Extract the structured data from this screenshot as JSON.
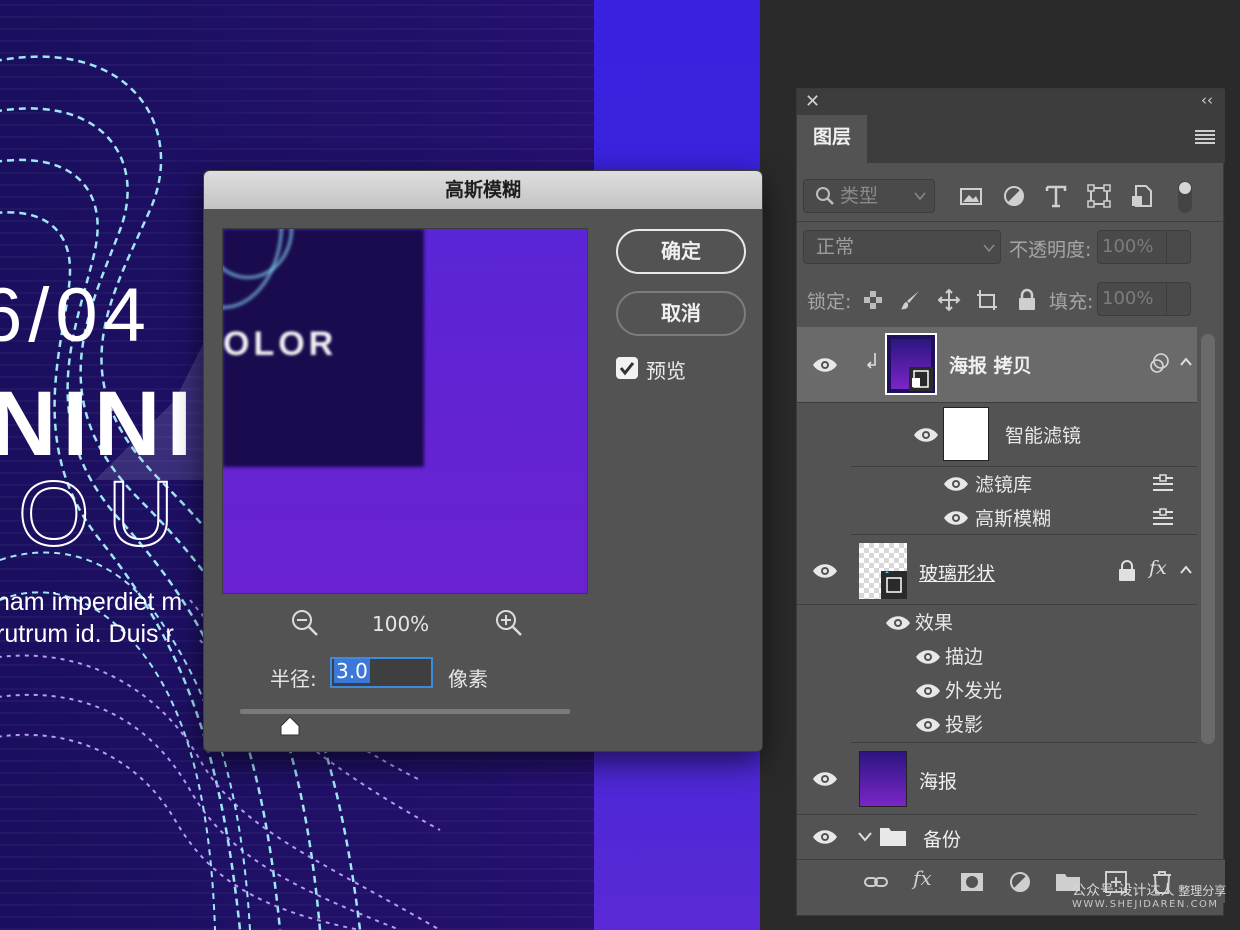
{
  "canvas": {
    "date_text": "6/04",
    "big_text": "NINI",
    "outline_text": "OU",
    "body_line_1": "nam imperdiet m",
    "body_line_2": "rutrum id. Duis r"
  },
  "dialog": {
    "title": "高斯模糊",
    "ok_label": "确定",
    "cancel_label": "取消",
    "preview_label": "预览",
    "preview_checked": true,
    "preview_image_text": "OLOR",
    "zoom": "100%",
    "radius_label": "半径:",
    "radius_value": "3.0",
    "radius_unit": "像素"
  },
  "layers_panel": {
    "tab": "图层",
    "kind_filter": "类型",
    "blend_mode": "正常",
    "opacity_label": "不透明度:",
    "opacity_value": "100%",
    "lock_label": "锁定:",
    "fill_label": "填充:",
    "fill_value": "100%",
    "layers": [
      {
        "name": "海报 拷贝"
      },
      {
        "name": "智能滤镜"
      },
      {
        "name": "滤镜库"
      },
      {
        "name": "高斯模糊"
      },
      {
        "name": "玻璃形状"
      },
      {
        "name": "效果"
      },
      {
        "name": "描边"
      },
      {
        "name": "外发光"
      },
      {
        "name": "投影"
      },
      {
        "name": "海报"
      },
      {
        "name": "备份"
      }
    ],
    "fx_label": "fx"
  },
  "watermark": {
    "line1": "公众号·设计达人",
    "line1b": "整理分享",
    "line2": "WWW.SHEJIDAREN.COM"
  },
  "colors": {
    "accent_blue": "#3d8be0",
    "panel_bg": "#535353",
    "dialog_bg": "#535353",
    "canvas_purple": "#22106a"
  }
}
